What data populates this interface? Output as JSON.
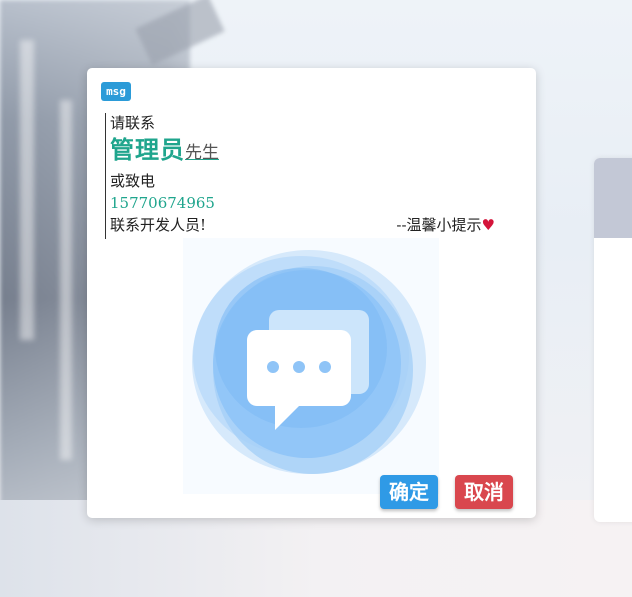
{
  "dialog": {
    "badge": "msg",
    "line1": "请联系",
    "admin": "管理员",
    "sir": "先生",
    "line3": "或致电",
    "phone": "15770674965",
    "line5": "联系开发人员!",
    "tip": "--温馨小提示",
    "heart": "♥",
    "illustration_icon": "chat-bubble-icon",
    "ok_label": "确定",
    "cancel_label": "取消"
  },
  "colors": {
    "accent_green": "#1fa58d",
    "ok_blue": "#2f9ae6",
    "cancel_red": "#d9474e",
    "badge_blue": "#2b9bd8",
    "heart_red": "#d4143a"
  }
}
